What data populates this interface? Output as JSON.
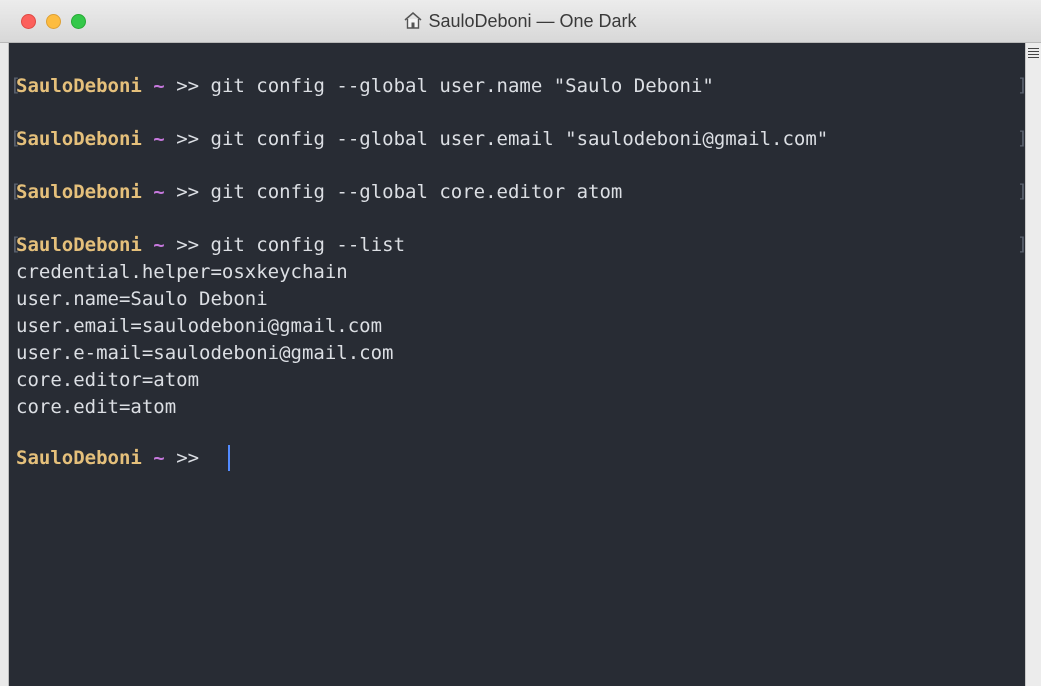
{
  "window": {
    "title": "SauloDeboni — One Dark"
  },
  "prompt": {
    "user": "SauloDeboni",
    "dir": "~",
    "symbol": ">>"
  },
  "terminal": {
    "commands": [
      "git config --global user.name \"Saulo Deboni\"",
      "git config --global user.email \"saulodeboni@gmail.com\"",
      "git config --global core.editor atom",
      "git config --list"
    ],
    "output": [
      "credential.helper=osxkeychain",
      "user.name=Saulo Deboni",
      "user.email=saulodeboni@gmail.com",
      "user.e-mail=saulodeboni@gmail.com",
      "core.editor=atom",
      "core.edit=atom"
    ]
  },
  "colors": {
    "background": "#282c34",
    "user": "#e5c07b",
    "tilde": "#c678dd",
    "text": "#dcdfe4",
    "cursor": "#528bff"
  },
  "icons": {
    "title": "home-icon",
    "right_edge": "scroll-lines-icon"
  }
}
